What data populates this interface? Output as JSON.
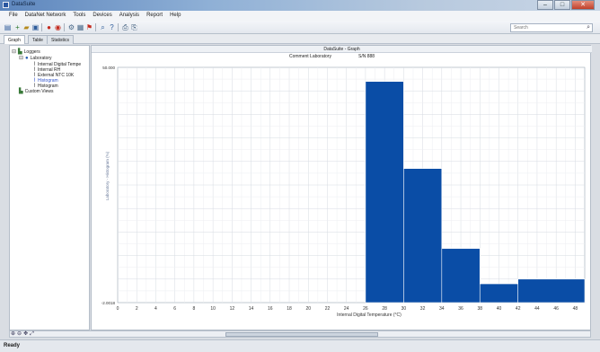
{
  "window": {
    "title": "DataSuite"
  },
  "menu": [
    "File",
    "DataNet Network",
    "Tools",
    "Devices",
    "Analysis",
    "Report",
    "Help"
  ],
  "toolbar": {
    "icons": [
      "new-icon",
      "add-icon",
      "open-folder-icon",
      "save-icon",
      "stop-icon",
      "record-icon",
      "settings-icon",
      "grid-icon",
      "flag-icon",
      "zoom-icon",
      "help-icon",
      "print-icon",
      "print-preview-icon"
    ]
  },
  "search": {
    "placeholder": "Search"
  },
  "tabs": [
    "Graph",
    "Table",
    "Statistics"
  ],
  "tree": {
    "root": "Loggers",
    "logger": "Laboratory",
    "sensors": [
      "Internal Digital Tempe",
      "Internal RH",
      "External NTC 10K",
      "Histogram"
    ],
    "extra": "Histogram",
    "custom": "Custom Views"
  },
  "graph": {
    "panel_title": "DataSuite - Graph",
    "subtitle": "Comment Laboratory",
    "serial": "S/N 888"
  },
  "status": {
    "text": "Ready"
  },
  "colors": {
    "bar": "#0a4da6",
    "accent": "#5d86bd"
  },
  "chart_data": {
    "type": "bar",
    "title": "",
    "xlabel": "Internal Digital Temperature (°C)",
    "ylabel": "Laboratory - Histogram (%)",
    "x_ticks": [
      0,
      2,
      4,
      6,
      8,
      10,
      12,
      14,
      16,
      18,
      20,
      22,
      24,
      26,
      28,
      30,
      32,
      34,
      36,
      38,
      40,
      42,
      44,
      46,
      48
    ],
    "xlim": [
      0,
      49
    ],
    "y_top_label": "50.000",
    "y_bottom_label": "-2.0018",
    "ylim": [
      0,
      50
    ],
    "bins": [
      {
        "from": 26,
        "to": 30,
        "value": 47
      },
      {
        "from": 30,
        "to": 34,
        "value": 28.5
      },
      {
        "from": 34,
        "to": 38,
        "value": 11.5
      },
      {
        "from": 38,
        "to": 42,
        "value": 4
      },
      {
        "from": 42,
        "to": 49,
        "value": 5
      }
    ],
    "grid": true
  }
}
